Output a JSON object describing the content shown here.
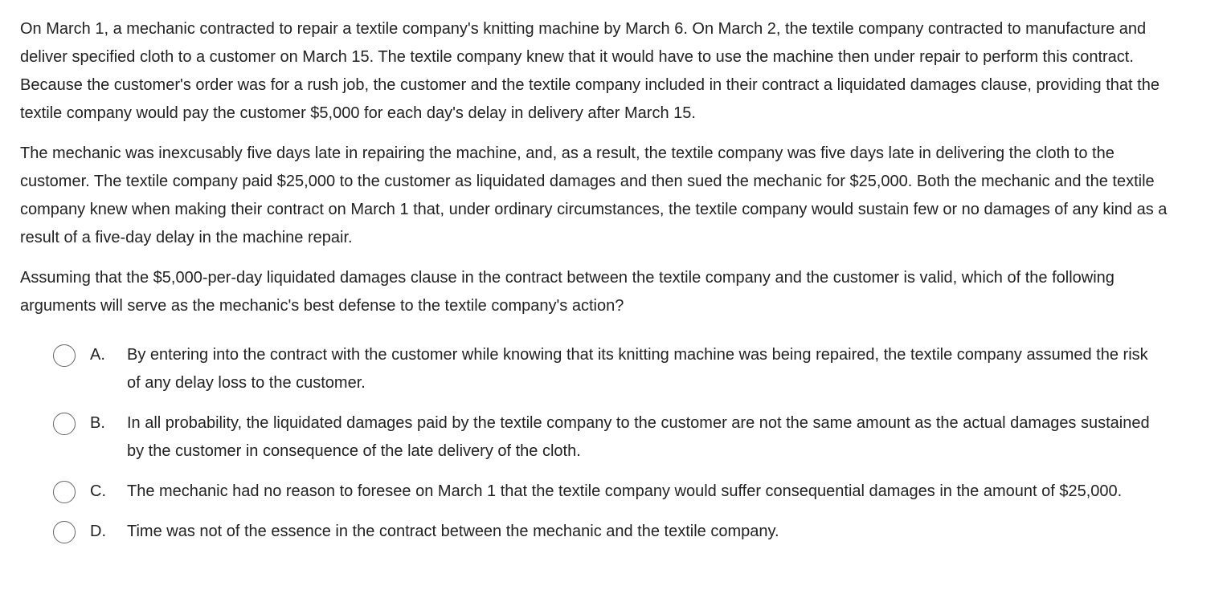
{
  "question": {
    "paragraphs": [
      "On March 1, a mechanic contracted to repair a textile company's knitting machine by March 6.  On March 2, the textile company contracted to manufacture and deliver specified cloth to a customer on March 15.  The textile company knew that it would have to use the machine then under repair to perform this contract.  Because the customer's order was for a rush job, the customer and the textile company included in their contract a liquidated damages clause, providing that the textile company would pay the customer $5,000 for each day's delay in delivery after March 15.",
      "The mechanic was inexcusably five days late in repairing the machine, and, as a result, the textile company was five days late in delivering the cloth to the customer.  The textile company paid $25,000 to the customer as liquidated damages and then sued the mechanic for $25,000.  Both the mechanic and the textile company knew when making their contract on March 1 that, under ordinary circumstances, the textile company would sustain few or no damages of any kind as a result of a five-day delay in the machine repair.",
      "Assuming that the $5,000-per-day liquidated damages clause in the contract between the textile company and the customer is valid, which of the following arguments will serve as the mechanic's best defense to the textile company's action?"
    ]
  },
  "options": [
    {
      "letter": "A.",
      "text": "By entering into the contract with the customer while knowing that its knitting machine was being repaired, the textile company assumed the risk of any delay loss to the customer."
    },
    {
      "letter": "B.",
      "text": "In all probability, the liquidated damages paid by the textile company to the customer are not the same amount as the actual damages sustained by the customer in consequence of the late delivery of the cloth."
    },
    {
      "letter": "C.",
      "text": "The mechanic had no reason to foresee on March 1 that the textile company would suffer consequential damages in the amount of $25,000."
    },
    {
      "letter": "D.",
      "text": "Time was not of the essence in the contract between the mechanic and the textile company."
    }
  ]
}
